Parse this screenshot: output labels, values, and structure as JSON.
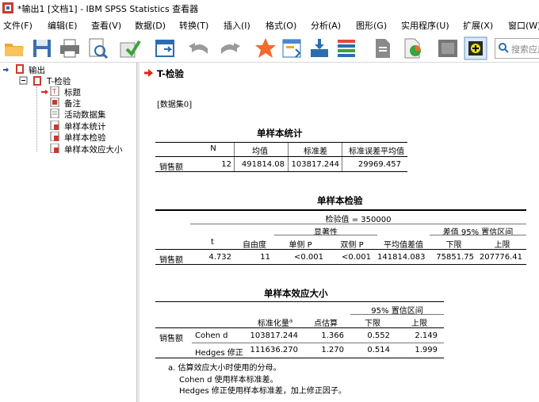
{
  "window": {
    "title": "*输出1 [文档1] - IBM SPSS Statistics 查看器"
  },
  "menu": [
    "文件(F)",
    "编辑(E)",
    "查看(V)",
    "数据(D)",
    "转换(T)",
    "插入(I)",
    "格式(O)",
    "分析(A)",
    "图形(G)",
    "实用程序(U)",
    "扩展(X)",
    "窗口(W)"
  ],
  "toolbar": {
    "search_placeholder": "搜索应用"
  },
  "tree": {
    "root": "输出",
    "node": "T-检验",
    "children": [
      "标题",
      "备注",
      "活动数据集",
      "单样本统计",
      "单样本检验",
      "单样本效应大小"
    ]
  },
  "output": {
    "section_title": "T-检验",
    "dataset": "[数据集0]",
    "stats": {
      "title": "单样本统计",
      "headers": [
        "N",
        "均值",
        "标准差",
        "标准误差平均值"
      ],
      "row": {
        "label": "销售额",
        "values": [
          "12",
          "491814.08",
          "103817.244",
          "29969.457"
        ]
      }
    },
    "test": {
      "title": "单样本检验",
      "test_value": "检验值 = 350000",
      "sig_header": "显著性",
      "ci_header": "差值 95% 置信区间",
      "headers": [
        "t",
        "自由度",
        "单侧 P",
        "双侧 P",
        "平均值差值",
        "下限",
        "上限"
      ],
      "row": {
        "label": "销售额",
        "values": [
          "4.732",
          "11",
          "<0.001",
          "<0.001",
          "141814.083",
          "75851.75",
          "207776.41"
        ]
      }
    },
    "effect": {
      "title": "单样本效应大小",
      "ci_header": "95% 置信区间",
      "headers": [
        "标准化量",
        "点估算",
        "下限",
        "上限"
      ],
      "std_sup": "a",
      "row_label": "销售额",
      "rows": [
        {
          "name": "Cohen d",
          "values": [
            "103817.244",
            "1.366",
            "0.552",
            "2.149"
          ]
        },
        {
          "name": "Hedges 修正",
          "values": [
            "111636.270",
            "1.270",
            "0.514",
            "1.999"
          ]
        }
      ],
      "footnotes": [
        "a. 估算效应大小时使用的分母。",
        "Cohen d 使用样本标准差。",
        "Hedges 修正使用样本标准差，加上修正因子。"
      ]
    }
  }
}
